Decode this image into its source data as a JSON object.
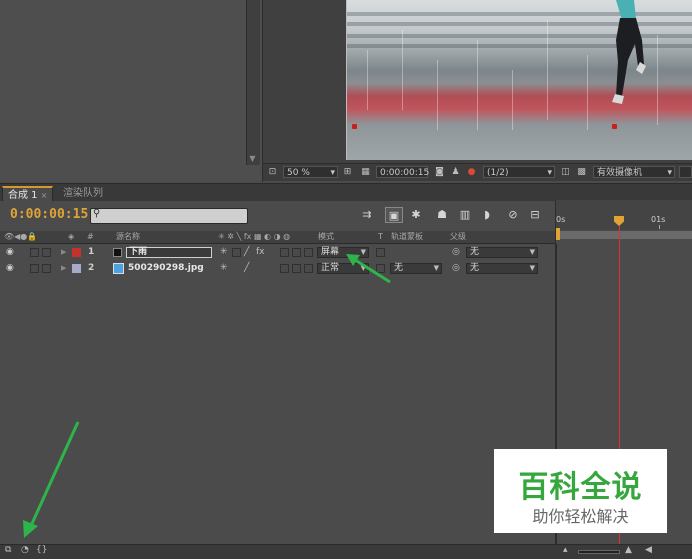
{
  "viewer": {
    "zoom": "50 %",
    "timecode": "0:00:00:15",
    "resolution": "(1/2)",
    "camera": "有效摄像机"
  },
  "tabs": {
    "comp": "合成 1",
    "close": "×",
    "render_queue": "渲染队列"
  },
  "timeline": {
    "timecode": "0:00:00:15",
    "search_placeholder": "",
    "ruler": [
      "0s",
      "01s"
    ]
  },
  "columns": {
    "number": "#",
    "source_name": "源名称",
    "mode": "模式",
    "t": "T",
    "trkmat": "轨道蒙板",
    "parent": "父级"
  },
  "layers": [
    {
      "number": "1",
      "name": "下雨",
      "label_color": "#c3322c",
      "mode": "屏幕",
      "trkmat": "",
      "parent": "无",
      "bar_color": "#c04a50"
    },
    {
      "number": "2",
      "name": "500290298.jpg",
      "label_color": "#a9a9c9",
      "mode": "正常",
      "trkmat": "无",
      "parent": "无",
      "bar_color": "#7e7a9e"
    }
  ],
  "watermark": {
    "title": "百科全说",
    "subtitle": "助你轻松解决"
  },
  "colors": {
    "accent": "#e0a436",
    "arrow": "#2db44a",
    "cti": "#e0312f"
  }
}
